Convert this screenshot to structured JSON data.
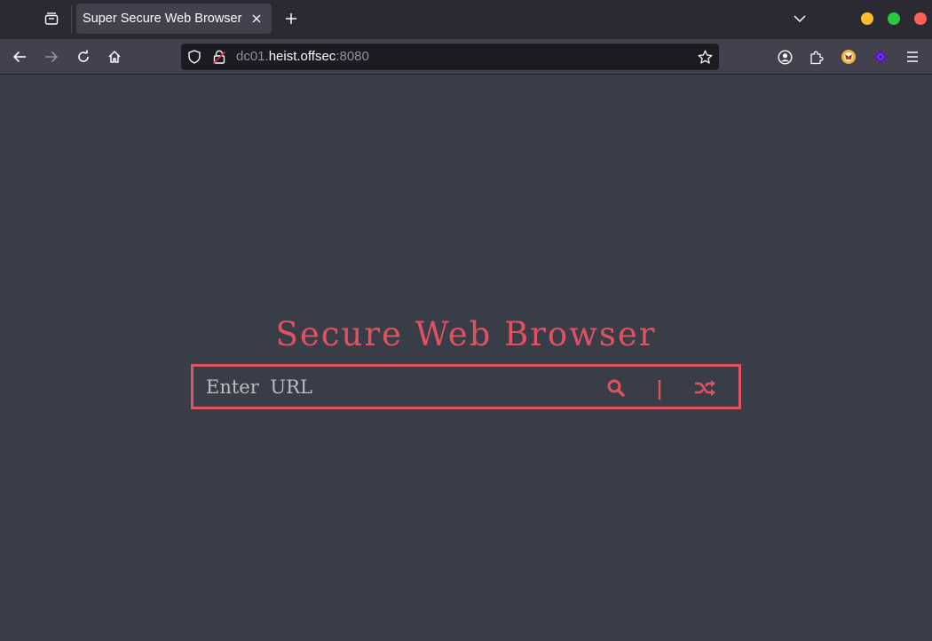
{
  "tab": {
    "title": "Super Secure Web Browser"
  },
  "urlbar": {
    "prefix": "dc01.",
    "host": "heist.offsec",
    "suffix": ":8080"
  },
  "page": {
    "heading": "Secure Web Browser",
    "input_placeholder": "Enter URL",
    "divider_text": "|"
  },
  "icons": {
    "tab_list": "tab-list-icon",
    "tab_close": "close-icon",
    "new_tab": "plus-icon",
    "tab_overflow": "chevron-down-icon",
    "back": "back-arrow-icon",
    "forward": "forward-arrow-icon",
    "reload": "reload-icon",
    "home": "home-icon",
    "shield": "shield-icon",
    "lock": "insecure-lock-icon",
    "bookmark": "star-icon",
    "account": "account-icon",
    "extensions": "puzzle-icon",
    "extension_1": "extension-fox-icon",
    "extension_2": "extension-gem-icon",
    "menu": "hamburger-menu-icon",
    "search": "search-icon",
    "shuffle": "shuffle-icon"
  },
  "colors": {
    "accent": "#e0525f",
    "page_background": "#383d47",
    "toolbar_background": "#42414d",
    "tabstrip_background": "#2b2a33"
  }
}
